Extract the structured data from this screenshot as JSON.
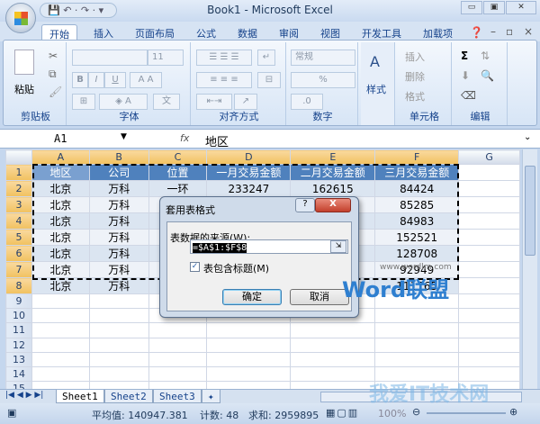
{
  "window": {
    "title": "Book1 - Microsoft Excel",
    "qat": "💾 ↶ · ↷ · ▾"
  },
  "tabs": [
    "开始",
    "插入",
    "页面布局",
    "公式",
    "数据",
    "审阅",
    "视图",
    "开发工具",
    "加载项"
  ],
  "ribbon": {
    "clipboard": {
      "label": "剪贴板",
      "paste": "粘贴"
    },
    "font": {
      "label": "字体",
      "size": "11",
      "bold": "B",
      "italic": "I",
      "underline": "U"
    },
    "alignment": {
      "label": "对齐方式"
    },
    "number": {
      "label": "数字",
      "format": "常规",
      "percent": "%"
    },
    "styles": {
      "label": "样式"
    },
    "cells": {
      "label": "单元格",
      "insert": "插入",
      "delete": "删除",
      "format": "格式"
    },
    "editing": {
      "label": "编辑",
      "sum": "Σ"
    }
  },
  "formula_bar": {
    "name_box": "A1",
    "fx": "fx",
    "value": "地区"
  },
  "columns": [
    "A",
    "B",
    "C",
    "D",
    "E",
    "F",
    "G"
  ],
  "rows": [
    [
      "地区",
      "公司",
      "位置",
      "一月交易金额",
      "二月交易金额",
      "三月交易金额"
    ],
    [
      "北京",
      "万科",
      "一环",
      "233247",
      "162615",
      "84424"
    ],
    [
      "北京",
      "万科",
      "",
      "",
      "",
      "85285"
    ],
    [
      "北京",
      "万科",
      "",
      "",
      "",
      "84983"
    ],
    [
      "北京",
      "万科",
      "",
      "",
      "",
      "152521"
    ],
    [
      "北京",
      "万科",
      "",
      "",
      "",
      "128708"
    ],
    [
      "北京",
      "万科",
      "",
      "",
      "",
      "92949"
    ],
    [
      "北京",
      "万科",
      "",
      "",
      "",
      "111765"
    ]
  ],
  "row_numbers": [
    "1",
    "2",
    "3",
    "4",
    "5",
    "6",
    "7",
    "8",
    "9",
    "10",
    "11",
    "12",
    "13",
    "14",
    "15"
  ],
  "sheets": [
    "Sheet1",
    "Sheet2",
    "Sheet3"
  ],
  "status": {
    "average": "平均值: 140947.381",
    "count": "计数: 48",
    "sum": "求和: 2959895",
    "zoom": "100%"
  },
  "dialog": {
    "title": "套用表格式",
    "source_label": "表数据的来源(W):",
    "source_value": "=$A$1:$F$8",
    "has_headers_label": "表包含标题(M)",
    "has_headers": true,
    "ok": "确定",
    "cancel": "取消"
  },
  "watermark": {
    "url": "www.wordlm.com",
    "brand": "Word联盟",
    "brand2": "我爱IT技术网"
  }
}
